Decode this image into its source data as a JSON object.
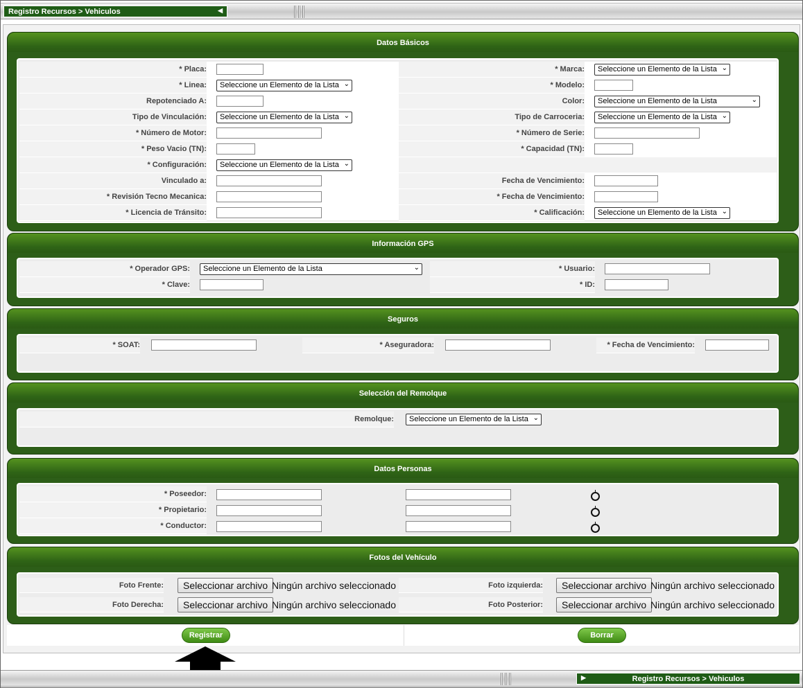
{
  "topbar": {
    "title": "Registro Recursos > Vehiculos"
  },
  "bottombar": {
    "title": "Registro Recursos > Vehiculos"
  },
  "datos_basicos": {
    "title": "Datos Básicos",
    "placa": "* Placa:",
    "marca": "* Marca:",
    "linea": "* Linea:",
    "modelo": "* Modelo:",
    "repotenciado": "Repotenciado A:",
    "color": "Color:",
    "tipo_vinculacion": "Tipo de Vinculación:",
    "tipo_carroceria": "Tipo de Carroceria:",
    "numero_motor": "* Número de Motor:",
    "numero_serie": "* Número de Serie:",
    "peso_vacio": "* Peso Vacio (TN):",
    "capacidad": "* Capacidad (TN):",
    "configuracion": "* Configuración:",
    "vinculado": "Vinculado a:",
    "fecha_venc1": "Fecha de Vencimiento:",
    "revision": "* Revisión Tecno Mecanica:",
    "fecha_venc2": "* Fecha de Vencimiento:",
    "licencia": "* Licencia de Tránsito:",
    "calificacion": "* Calificación:"
  },
  "select_placeholder": "Seleccione un Elemento de la Lista",
  "gps": {
    "title": "Información GPS",
    "operador": "* Operador GPS:",
    "usuario": "* Usuario:",
    "clave": "* Clave:",
    "id": "* ID:"
  },
  "seguros": {
    "title": "Seguros",
    "soat": "* SOAT:",
    "aseguradora": "* Aseguradora:",
    "fecha": "* Fecha de Vencimiento:"
  },
  "remolque": {
    "title": "Selección del Remolque",
    "label": "Remolque:"
  },
  "personas": {
    "title": "Datos Personas",
    "poseedor": "* Poseedor:",
    "propietario": "* Propietario:",
    "conductor": "* Conductor:"
  },
  "fotos": {
    "title": "Fotos del Vehículo",
    "frente": "Foto Frente:",
    "derecha": "Foto Derecha:",
    "izquierda": "Foto izquierda:",
    "posterior": "Foto Posterior:",
    "btn": "Seleccionar archivo",
    "none": "Ningún archivo seleccionado"
  },
  "actions": {
    "registrar": "Registrar",
    "borrar": "Borrar"
  },
  "icons": {
    "back": "arrow-left-icon",
    "forward": "arrow-right-icon",
    "pointer": "pointer-arrow-icon",
    "search": "crosshair-icon"
  },
  "colors": {
    "panel": "#2d5e18",
    "header": "#1f5c16",
    "button": "#4c9a1e"
  }
}
